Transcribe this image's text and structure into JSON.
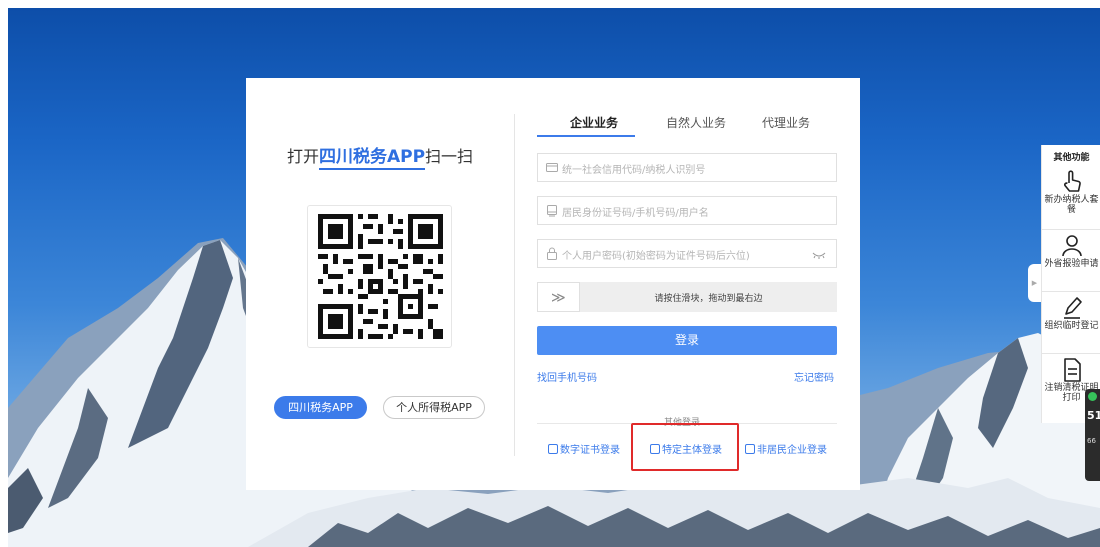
{
  "qr": {
    "title_prefix": "打开",
    "app_name": "四川税务APP",
    "title_suffix": "扫一扫"
  },
  "apps": {
    "sichuan": "四川税务APP",
    "personal": "个人所得税APP"
  },
  "tabs": [
    {
      "label": "企业业务",
      "active": true
    },
    {
      "label": "自然人业务",
      "active": false
    },
    {
      "label": "代理业务",
      "active": false
    }
  ],
  "form": {
    "credit_placeholder": "统一社会信用代码/纳税人识别号",
    "id_placeholder": "居民身份证号码/手机号码/用户名",
    "password_placeholder": "个人用户密码(初始密码为证件号码后六位)",
    "slider_text": "请按住滑块，拖动到最右边",
    "slider_handle": "≫",
    "login": "登录",
    "find_phone": "找回手机号码",
    "forgot_password": "忘记密码"
  },
  "other_login": {
    "label": "其他登录",
    "cert": "数字证书登录",
    "specific": "特定主体登录",
    "nonresident": "非居民企业登录"
  },
  "side_panel": {
    "title": "其他功能",
    "items": [
      {
        "label": "新办纳税人套餐",
        "icon": "hand-pointer-icon"
      },
      {
        "label": "外省报验申请",
        "icon": "user-icon"
      },
      {
        "label": "组织临时登记",
        "icon": "pen-icon"
      },
      {
        "label": "注销清税证明打印",
        "icon": "document-icon"
      }
    ],
    "collapse": "▶"
  },
  "net_widget": {
    "value": "51",
    "sub": "66"
  },
  "colors": {
    "accent": "#3c7bea",
    "login_button": "#4d8ef3",
    "highlight": "#e02a2a",
    "sky_top": "#0d4ea9"
  }
}
